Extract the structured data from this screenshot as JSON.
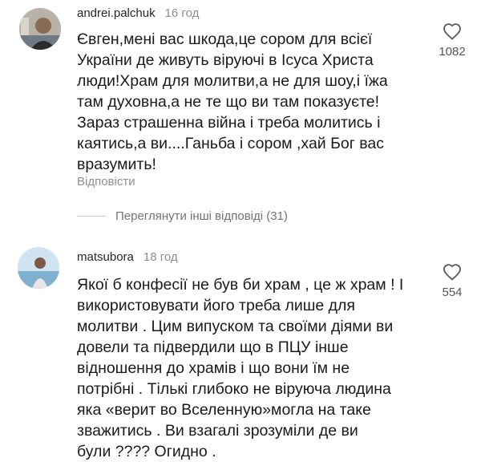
{
  "comments": [
    {
      "username": "andrei.palchuk",
      "time": "16 год",
      "lines": [
        "Євген,мені вас шкода,це сором для всієї",
        "України де живуть віруючі в Ісуса Христа",
        "люди!Храм для молитви,а не для шоу,і їжа",
        "там духовна,а не те що ви там показуєте!",
        "Зараз страшенна війна і треба молитись і",
        "каятись,а ви....Ганьба і сором ,хай Бог вас",
        "вразумить!"
      ],
      "like_count": "1082",
      "reply_label": "Відповісти"
    },
    {
      "username": "matsubora",
      "time": "18 год",
      "lines": [
        "Якої  б конфесії не був би храм , це ж храм ! І",
        "використовувати його треба лише для",
        "молитви . Цим випуском та своїми діями ви",
        "довели та підвердили що в ПЦУ інше",
        "відношення до храмів і що вони їм не",
        "потрібні . Тількі глибоко  не віруюча людина",
        "яка «верит во Вселенную»могла на таке",
        "зважитись . Ви взагалі зрозуміли де ви",
        "були ???? Огидно ."
      ],
      "like_count": "554"
    }
  ],
  "view_replies_label": "Переглянути інші відповіді (31)",
  "icons": {
    "like": "heart-outline-icon"
  },
  "colors": {
    "text": "#1a1a1a",
    "muted": "#8e8e8e",
    "background": "#ffffff"
  }
}
